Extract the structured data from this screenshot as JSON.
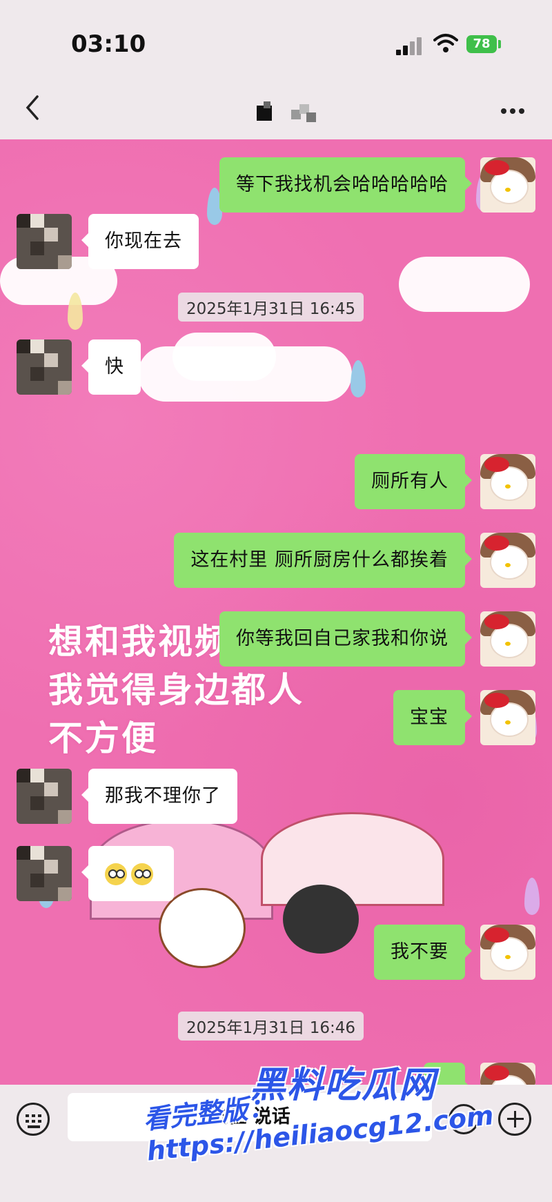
{
  "status": {
    "time": "03:10",
    "battery": "78"
  },
  "nav": {
    "contact_name_hidden": ""
  },
  "overlay_text": [
    "想和我视频",
    "我觉得身边都人",
    "不方便"
  ],
  "messages": [
    {
      "side": "me",
      "text": "等下我找机会哈哈哈哈哈"
    },
    {
      "side": "other",
      "text": "你现在去"
    },
    {
      "type": "timestamp",
      "text": "2025年1月31日 16:45"
    },
    {
      "side": "other",
      "text": "快"
    },
    {
      "side": "me",
      "text": "厕所有人"
    },
    {
      "side": "me",
      "text": "这在村里 厕所厨房什么都挨着"
    },
    {
      "side": "me",
      "text": "你等我回自己家我和你说"
    },
    {
      "side": "me",
      "text": "宝宝"
    },
    {
      "side": "other",
      "text": "那我不理你了"
    },
    {
      "side": "other",
      "text": "[emoji][emoji]"
    },
    {
      "side": "me",
      "text": "我不要"
    },
    {
      "type": "timestamp",
      "text": "2025年1月31日 16:46"
    }
  ],
  "input": {
    "hold_to_talk": "按住 说话"
  },
  "watermark": {
    "title": "黑料吃瓜网",
    "url": "看完整版：https://heiliaocg12.com"
  },
  "colors": {
    "my_bubble": "#8fe26f",
    "other_bubble": "#ffffff",
    "chat_bg": "#ef6fb1"
  }
}
